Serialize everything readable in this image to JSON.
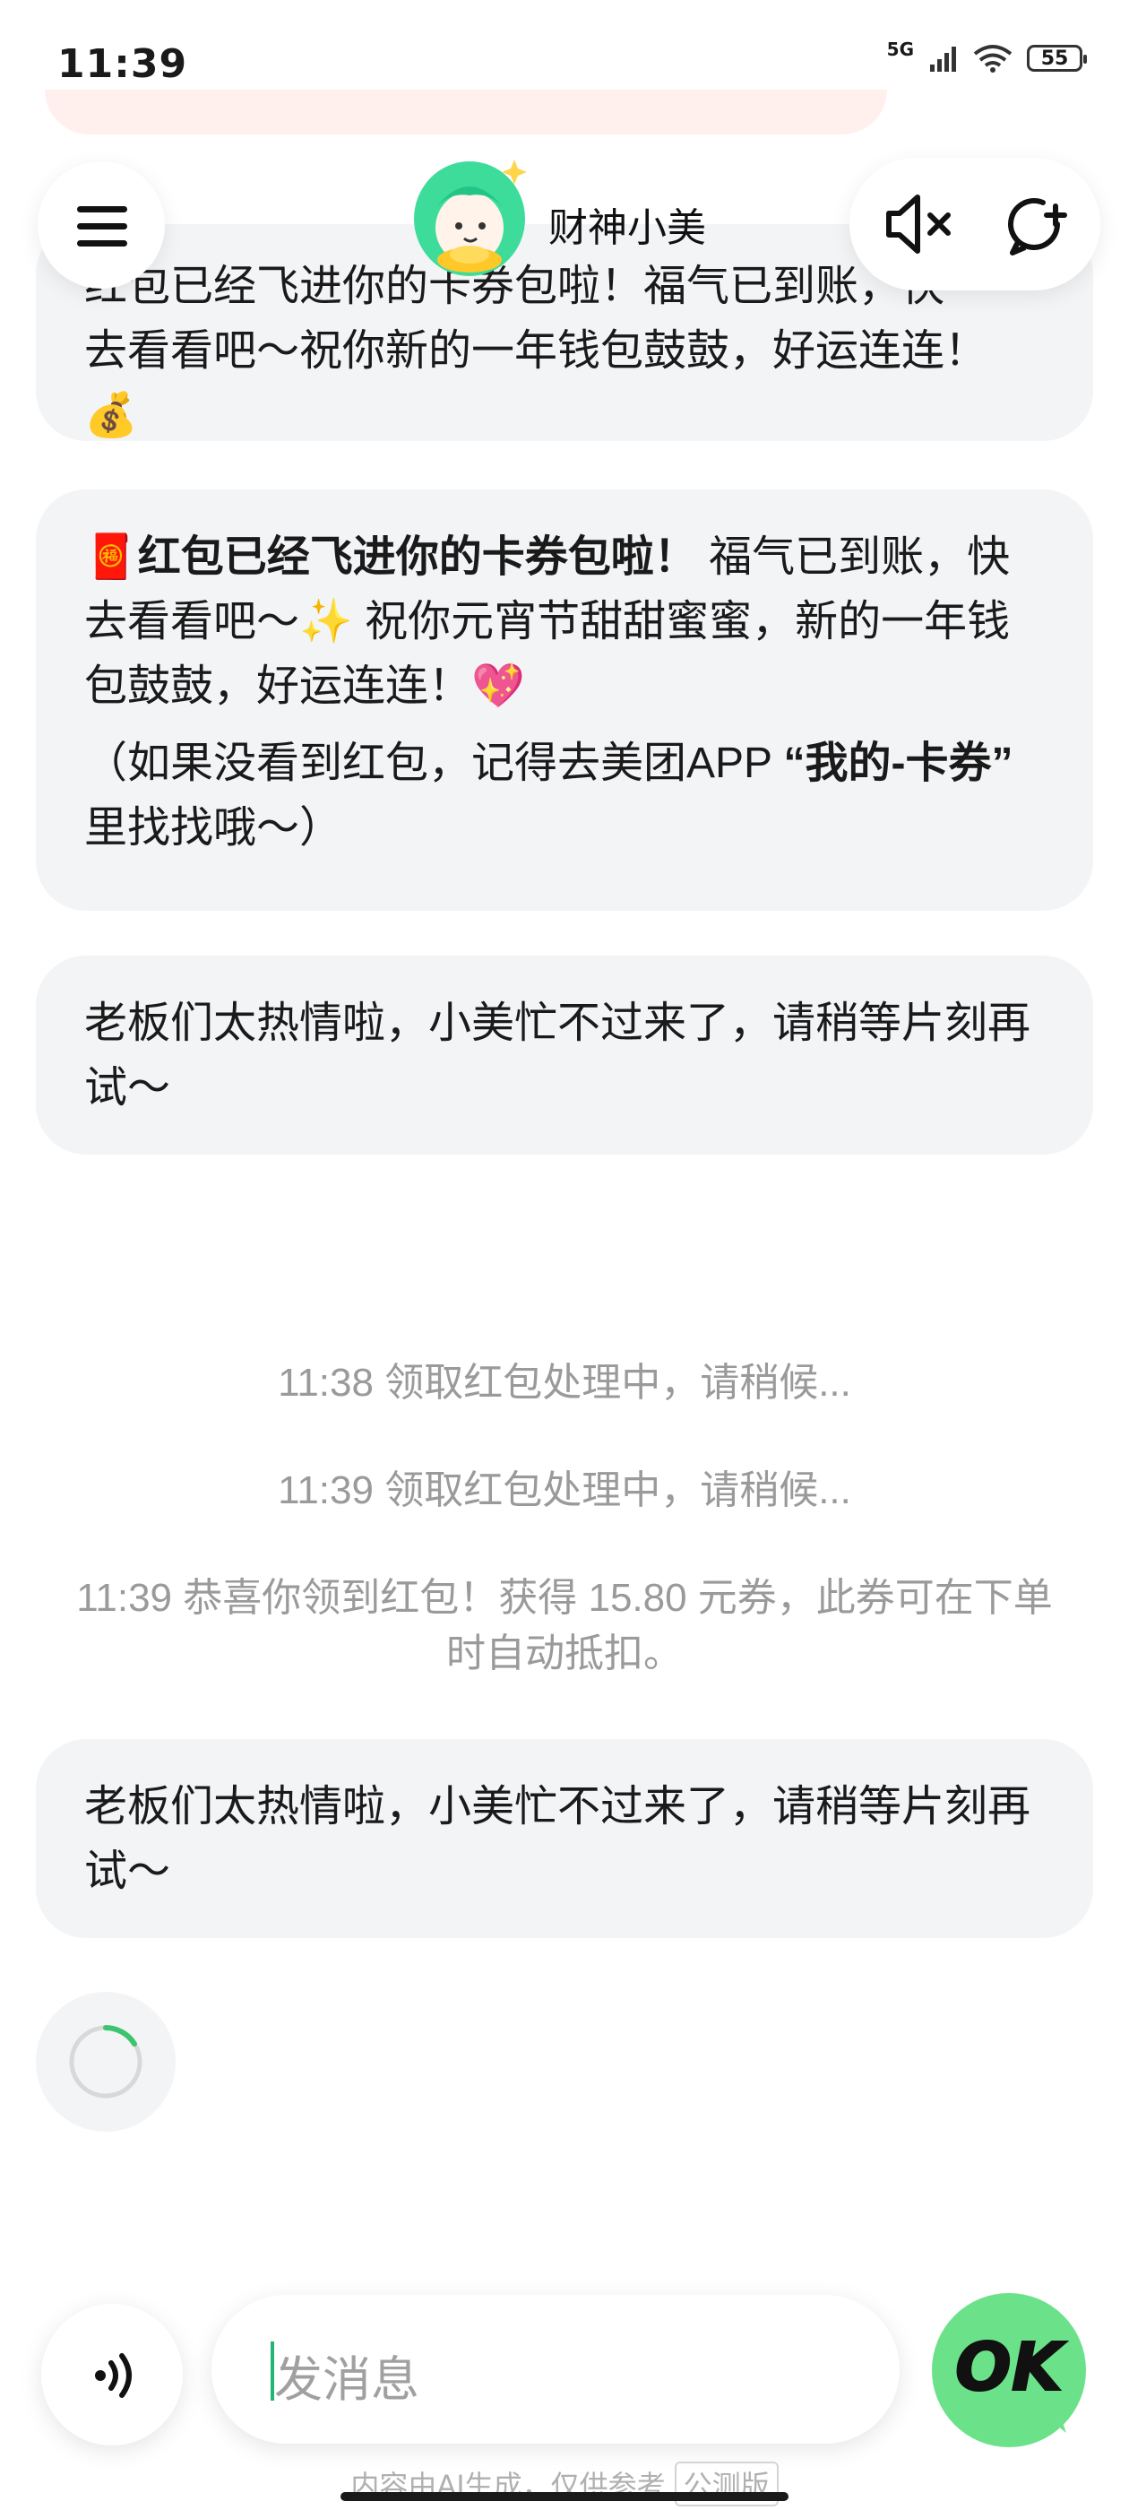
{
  "status_bar": {
    "time": "11:39",
    "network": "5G",
    "battery": "55"
  },
  "header": {
    "title": "财神小美"
  },
  "messages": [
    {
      "id": "partial",
      "line1": "红包已经飞进你的卡券包啦！福气已到账，快",
      "line2": "去看看吧～祝你新的一年钱包鼓鼓，好运连连！",
      "emoji": "💰"
    },
    {
      "id": "red-packet",
      "emoji": "🧧",
      "bold": "红包已经飞进你的卡券包啦！",
      "text": " 福气已到账，快去看看吧～✨ 祝你元宵节甜甜蜜蜜，新的一年钱包鼓鼓，好运连连！",
      "tail_emoji": "💖",
      "sub_prefix": "（如果没看到红包，记得去美团APP ",
      "sub_bold": "“我的-卡券”",
      "sub_suffix": " 里找找哦～）"
    },
    {
      "id": "busy-1",
      "text": "老板们太热情啦，小美忙不过来了，请稍等片刻再试～"
    },
    {
      "id": "busy-2",
      "text": "老板们太热情啦，小美忙不过来了，请稍等片刻再试～"
    }
  ],
  "system_messages": [
    "11:38 领取红包处理中，请稍候...",
    "11:39 领取红包处理中，请稍候...",
    "11:39 恭喜你领到红包！获得 15.80 元券，此券可在下单时自动抵扣。"
  ],
  "input": {
    "placeholder": "发消息"
  },
  "send_button": {
    "label": "OK"
  },
  "footer": {
    "disclaimer": "内容由AI生成，仅供参考",
    "badge": "公测版"
  },
  "colors": {
    "bubble": "#f3f4f6",
    "accent": "#6be289",
    "caret": "#22b573"
  }
}
